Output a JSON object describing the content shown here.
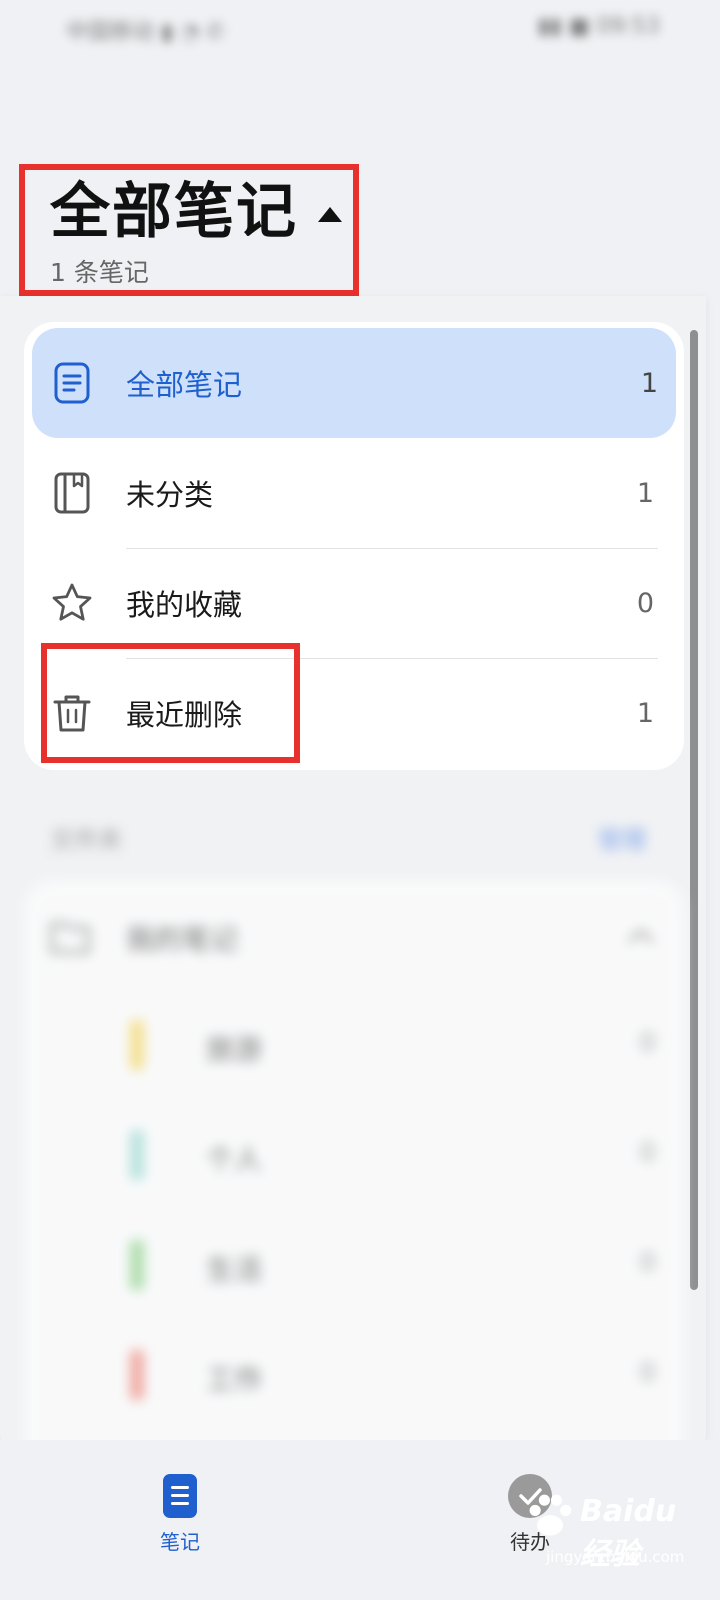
{
  "status_bar": {
    "left": "中国移动 ▮ ◔ ✆",
    "right": "▮▮ ■ 09:53"
  },
  "header": {
    "title": "全部笔记",
    "subtitle": "1 条笔记"
  },
  "categories": [
    {
      "label": "全部笔记",
      "count": "1",
      "icon": "note-icon",
      "active": true
    },
    {
      "label": "未分类",
      "count": "1",
      "icon": "notebook-icon",
      "active": false
    },
    {
      "label": "我的收藏",
      "count": "0",
      "icon": "star-icon",
      "active": false
    },
    {
      "label": "最近删除",
      "count": "1",
      "icon": "trash-icon",
      "active": false
    }
  ],
  "folders": {
    "label": "文件夹",
    "manage": "管理",
    "root": {
      "name": "我的笔记",
      "icon": "folder-icon"
    },
    "items": [
      {
        "name": "旅游",
        "count": "0",
        "color": "#f6d54a"
      },
      {
        "name": "个人",
        "count": "0",
        "color": "#8fd8cf"
      },
      {
        "name": "生活",
        "count": "0",
        "color": "#7fcf7a"
      },
      {
        "name": "工作",
        "count": "0",
        "color": "#f07a6a"
      }
    ]
  },
  "tabs": [
    {
      "label": "笔记",
      "icon": "notes-tab-icon",
      "active": true
    },
    {
      "label": "待办",
      "icon": "todo-check-icon",
      "active": false
    }
  ],
  "watermark": {
    "brand": "Baidu 经验",
    "url": "jingyan.baidu.com"
  },
  "colors": {
    "accent": "#1f5fce",
    "active_bg": "#cfe0fb",
    "highlight_box": "#e8302c"
  }
}
